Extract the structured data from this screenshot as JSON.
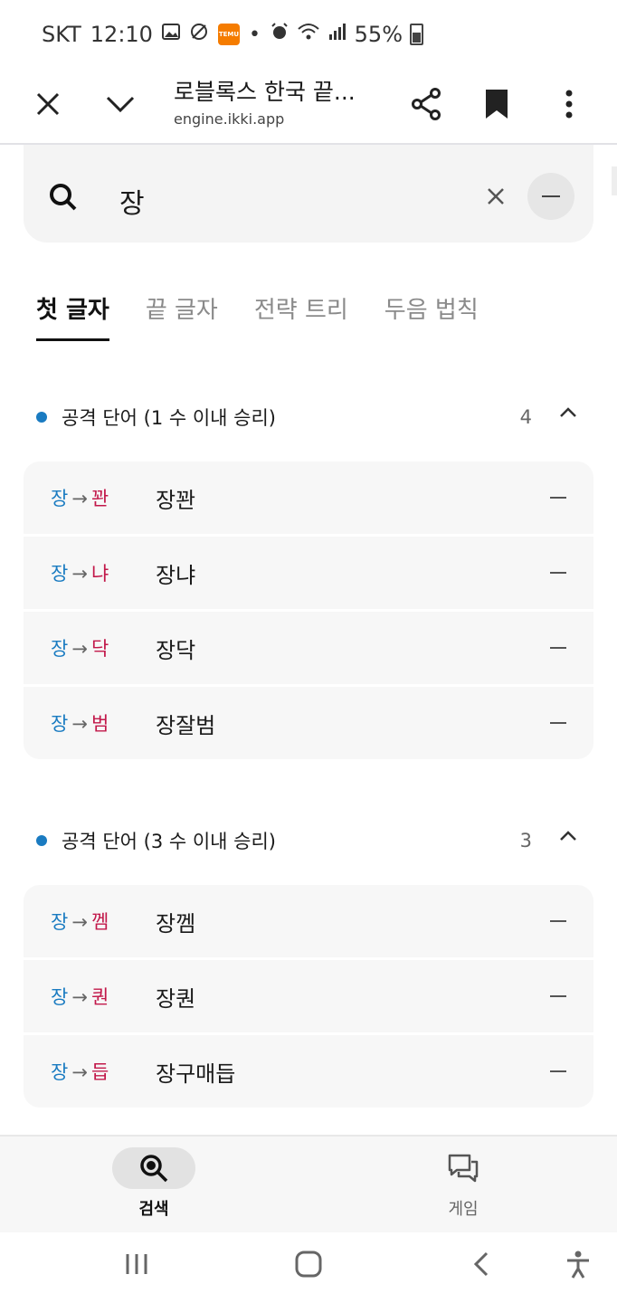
{
  "status_bar": {
    "carrier": "SKT",
    "time": "12:10",
    "battery": "55%",
    "icons": [
      "gallery-icon",
      "dnd-icon",
      "temu-app-icon",
      "dot-icon",
      "alarm-icon",
      "wifi-icon",
      "signal-icon",
      "battery-icon"
    ]
  },
  "browser": {
    "title": "로블록스 한국 끝...",
    "url": "engine.ikki.app",
    "icons": [
      "close-icon",
      "chevron-down-icon",
      "share-icon",
      "bookmark-icon",
      "more-vertical-icon"
    ]
  },
  "search": {
    "query": "장"
  },
  "tabs": [
    {
      "label": "첫 글자",
      "active": true
    },
    {
      "label": "끝 글자",
      "active": false
    },
    {
      "label": "전략 트리",
      "active": false
    },
    {
      "label": "두음 법칙",
      "active": false
    }
  ],
  "sections": [
    {
      "title": "공격 단어 (1 수 이내 승리)",
      "count": "4",
      "rows": [
        {
          "first": "장",
          "arrow": "→",
          "last": "꽌",
          "word": "장꽌"
        },
        {
          "first": "장",
          "arrow": "→",
          "last": "냐",
          "word": "장냐"
        },
        {
          "first": "장",
          "arrow": "→",
          "last": "닥",
          "word": "장닥"
        },
        {
          "first": "장",
          "arrow": "→",
          "last": "범",
          "word": "장잘범"
        }
      ]
    },
    {
      "title": "공격 단어 (3 수 이내 승리)",
      "count": "3",
      "rows": [
        {
          "first": "장",
          "arrow": "→",
          "last": "껨",
          "word": "장껨"
        },
        {
          "first": "장",
          "arrow": "→",
          "last": "퀀",
          "word": "장퀀"
        },
        {
          "first": "장",
          "arrow": "→",
          "last": "듭",
          "word": "장구매듭"
        }
      ]
    }
  ],
  "bottom_nav": [
    {
      "label": "검색",
      "icon": "search-icon",
      "active": true
    },
    {
      "label": "게임",
      "icon": "chat-icon",
      "active": false
    }
  ],
  "colors": {
    "accent_blue": "#1a7bc1",
    "accent_red": "#c2184a"
  }
}
